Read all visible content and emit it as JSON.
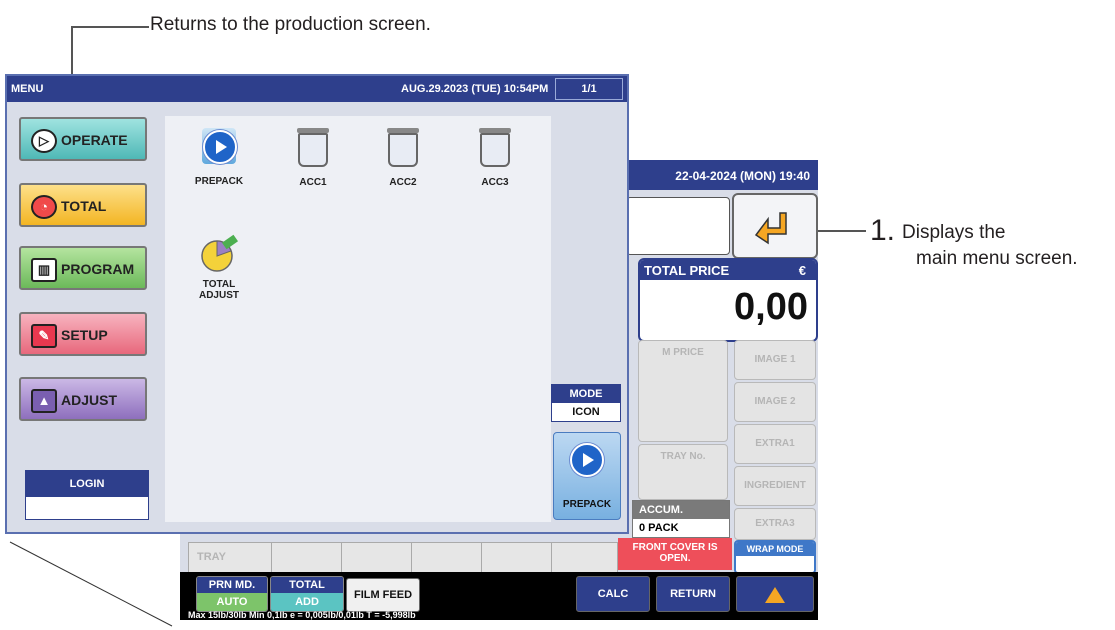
{
  "callouts": {
    "top": "Returns to the production screen.",
    "right_number": "1.",
    "right_line1": "Displays the",
    "right_line2": "main menu screen."
  },
  "production_screen": {
    "datetime": "22-04-2024 (MON)  19:40",
    "total_price_label": "TOTAL PRICE",
    "currency": "€",
    "total_price_value": "0,00",
    "m_price": "M PRICE",
    "tray_no": "TRAY No.",
    "side_buttons": [
      "IMAGE 1",
      "IMAGE 2",
      "EXTRA1",
      "INGREDIENT",
      "EXTRA3"
    ],
    "accum_label": "ACCUM.",
    "accum_value": "0 PACK",
    "front_cover_line1": "FRONT COVER IS",
    "front_cover_line2": "OPEN.",
    "wrap_mode": "WRAP MODE",
    "tray": "TRAY",
    "prn_md_label": "PRN MD.",
    "prn_md_value": "AUTO",
    "total_label": "TOTAL",
    "total_value": "ADD",
    "film_feed": "FILM FEED",
    "calc": "CALC",
    "return": "RETURN",
    "status_line": "Max 15lb/30lb  Min 0,1lb  e = 0,005lb/0,01lb  T = -5,998lb"
  },
  "menu": {
    "title": "MENU",
    "datetime": "AUG.29.2023 (TUE)  10:54PM",
    "page": "1/1",
    "side_buttons": {
      "operate": "OPERATE",
      "total": "TOTAL",
      "program": "PROGRAM",
      "setup": "SETUP",
      "adjust": "ADJUST"
    },
    "login": "LOGIN",
    "icons": {
      "prepack": "PREPACK",
      "acc1": "ACC1",
      "acc2": "ACC2",
      "acc3": "ACC3",
      "total_adjust_line1": "TOTAL",
      "total_adjust_line2": "ADJUST"
    },
    "mode_label": "MODE",
    "mode_value": "ICON",
    "prepack_shortcut": "PREPACK"
  },
  "colors": {
    "title_bar": "#2e3f8c",
    "operate": "#5bc4c2",
    "total": "#f6c232",
    "program": "#7dc46a",
    "setup": "#f07c8c",
    "adjust": "#9b7fc4",
    "accum_box": "#7a7a7a",
    "front_cover_warning": "#ee4f5a"
  }
}
